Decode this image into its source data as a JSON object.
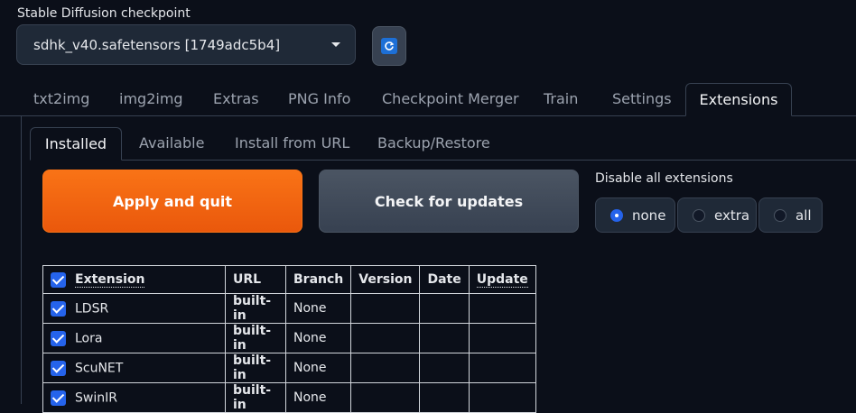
{
  "checkpoint": {
    "label": "Stable Diffusion checkpoint",
    "value": "sdhk_v40.safetensors [1749adc5b4]"
  },
  "main_tabs": [
    "txt2img",
    "img2img",
    "Extras",
    "PNG Info",
    "Checkpoint Merger",
    "Train",
    "Settings",
    "Extensions"
  ],
  "main_tab_selected": "Extensions",
  "sub_tabs": [
    "Installed",
    "Available",
    "Install from URL",
    "Backup/Restore"
  ],
  "sub_tab_selected": "Installed",
  "buttons": {
    "apply": "Apply and quit",
    "check": "Check for updates"
  },
  "disable": {
    "label": "Disable all extensions",
    "options": [
      "none",
      "extra",
      "all"
    ],
    "selected": "none"
  },
  "table": {
    "headers": [
      "Extension",
      "URL",
      "Branch",
      "Version",
      "Date",
      "Update"
    ],
    "rows": [
      {
        "name": "LDSR",
        "url": "built-in",
        "branch": "None",
        "version": "",
        "date": "",
        "update": "",
        "checked": true
      },
      {
        "name": "Lora",
        "url": "built-in",
        "branch": "None",
        "version": "",
        "date": "",
        "update": "",
        "checked": true
      },
      {
        "name": "ScuNET",
        "url": "built-in",
        "branch": "None",
        "version": "",
        "date": "",
        "update": "",
        "checked": true
      },
      {
        "name": "SwinIR",
        "url": "built-in",
        "branch": "None",
        "version": "",
        "date": "",
        "update": "",
        "checked": true
      }
    ]
  },
  "colors": {
    "accent_orange": "#f97316",
    "accent_blue": "#2563eb",
    "background": "#0b0f19"
  }
}
